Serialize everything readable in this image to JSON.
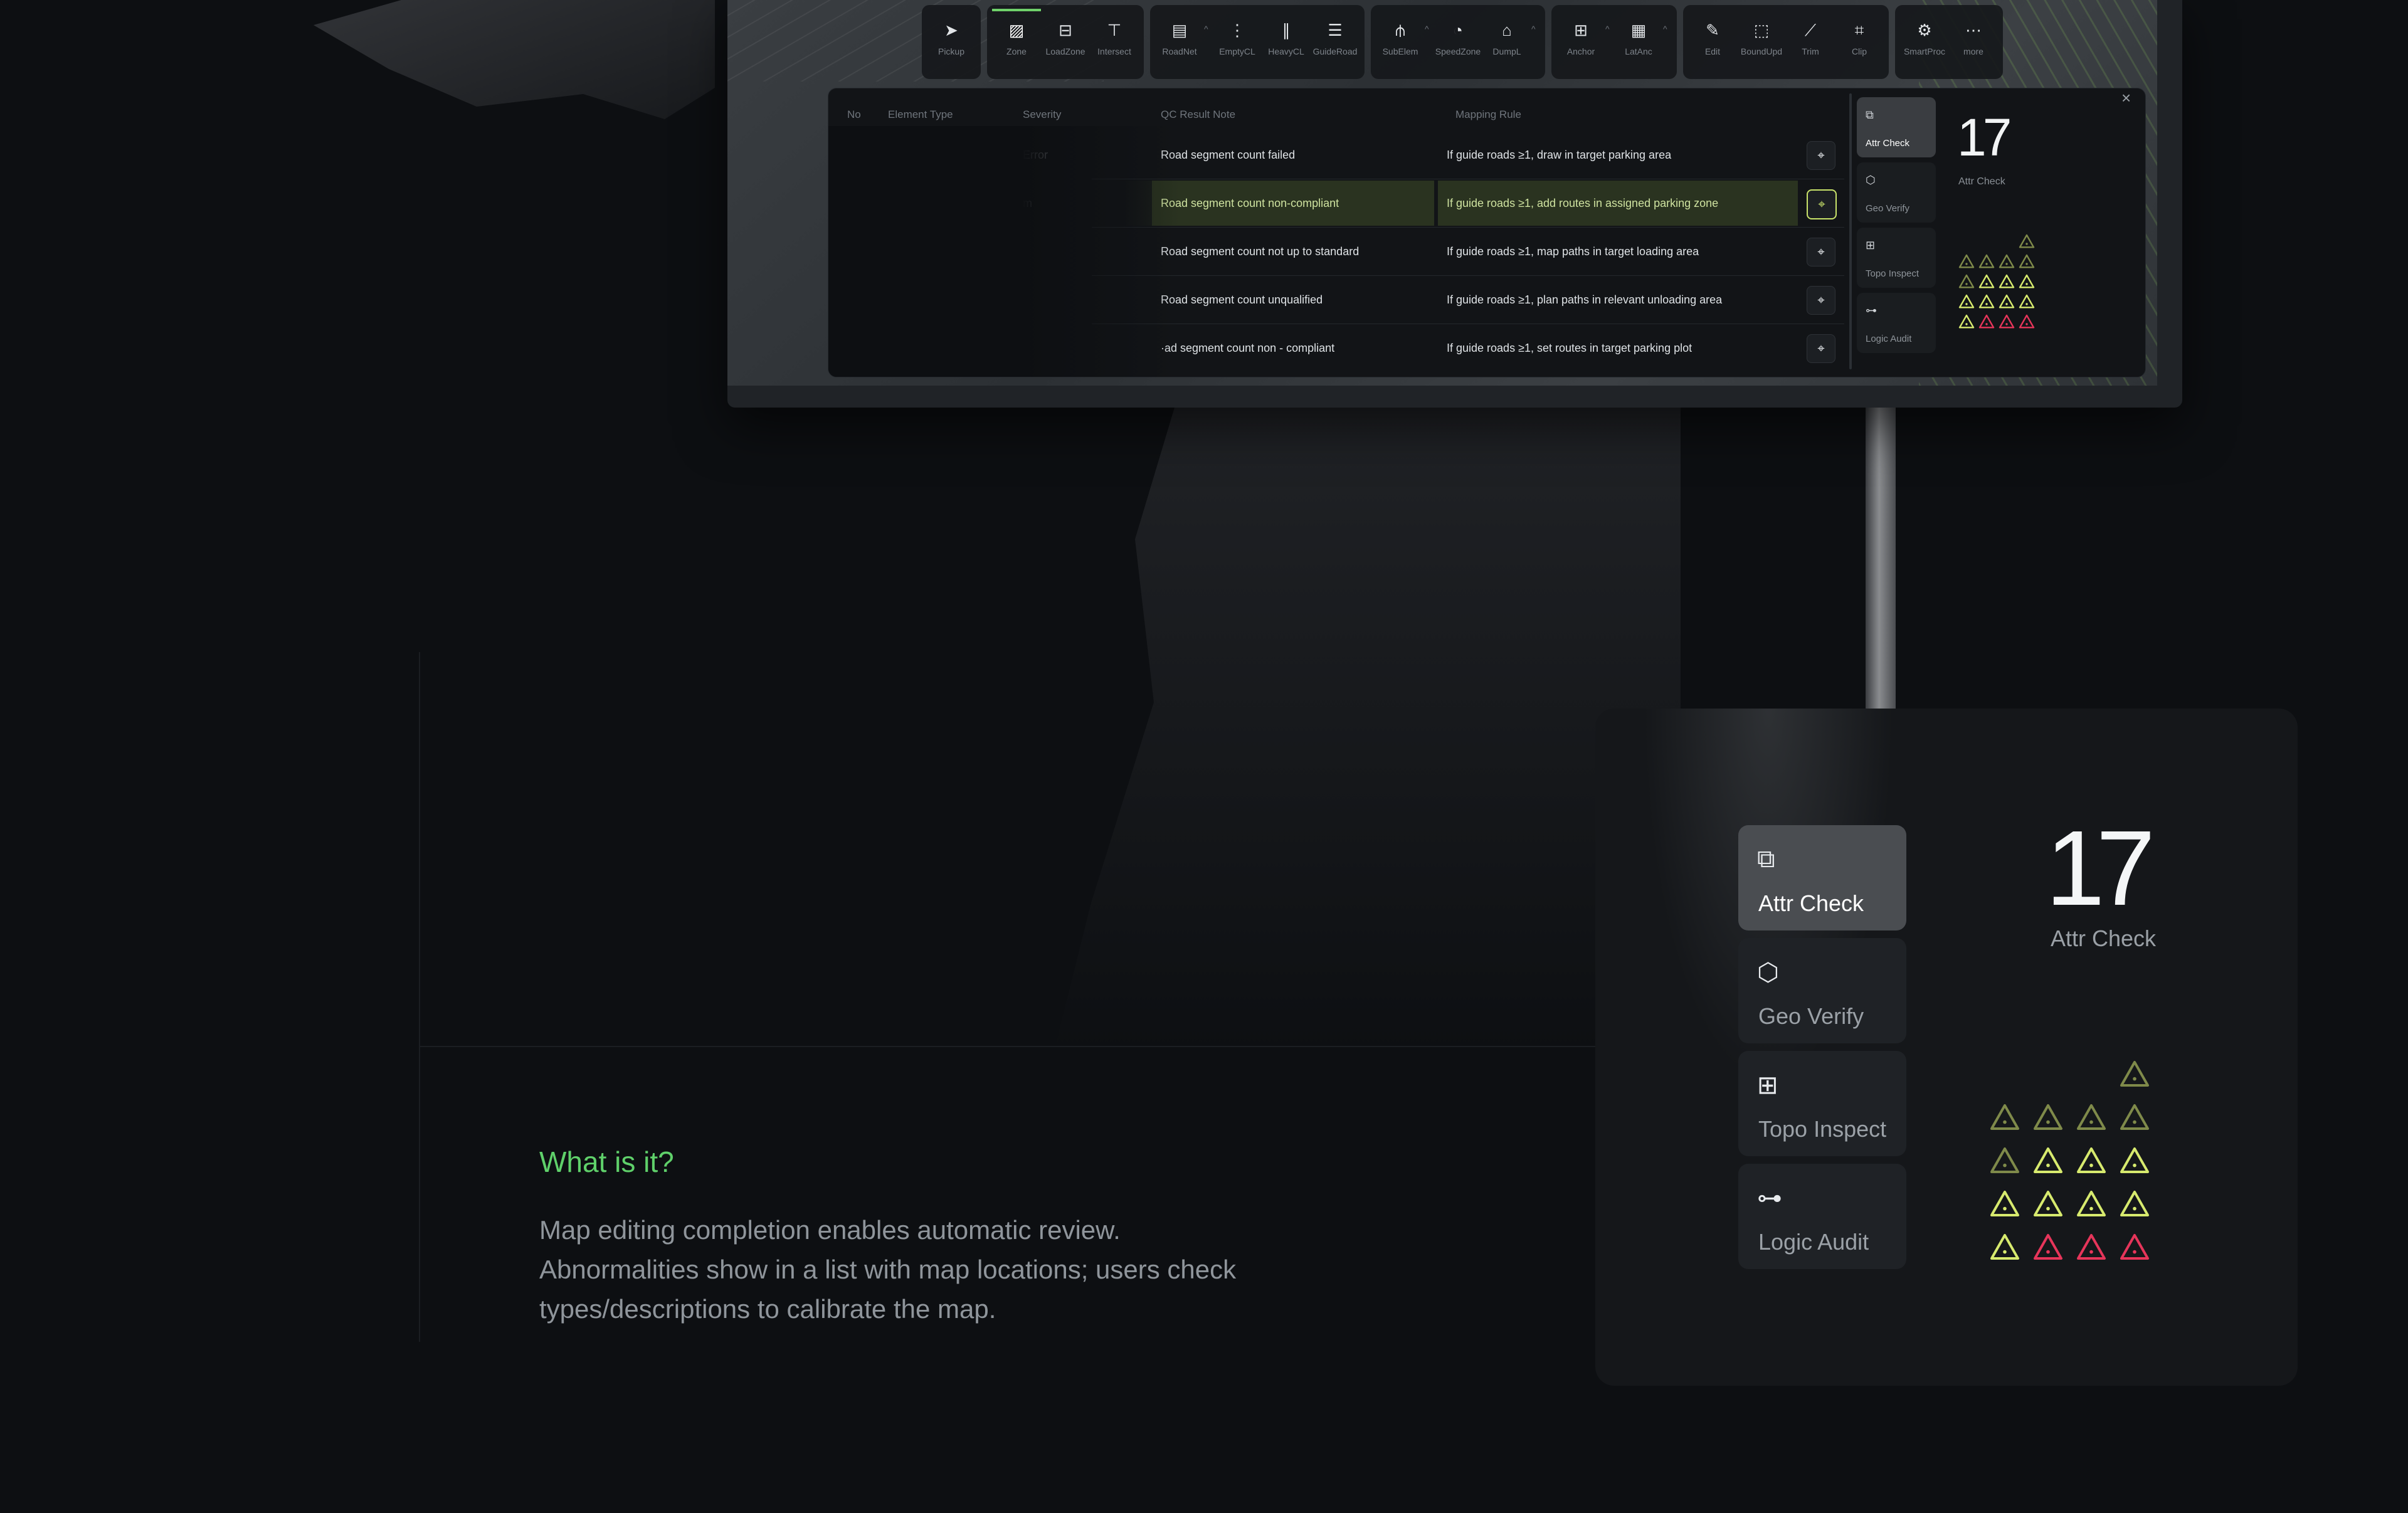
{
  "toolbar": {
    "groups": [
      [
        {
          "icon": "cursor-icon",
          "label": "Pickup"
        }
      ],
      [
        {
          "icon": "zone-icon",
          "label": "Zone",
          "active": true
        },
        {
          "icon": "loadzone-icon",
          "label": "LoadZone"
        },
        {
          "icon": "intersect-icon",
          "label": "Intersect"
        }
      ],
      [
        {
          "icon": "roadnet-icon",
          "label": "RoadNet",
          "caret": true
        },
        {
          "icon": "emptycl-icon",
          "label": "EmptyCL"
        },
        {
          "icon": "heavycl-icon",
          "label": "HeavyCL"
        },
        {
          "icon": "guideroad-icon",
          "label": "GuideRoad"
        }
      ],
      [
        {
          "icon": "subelem-icon",
          "label": "SubElem",
          "caret": true
        },
        {
          "icon": "speedzone-icon",
          "label": "SpeedZone"
        },
        {
          "icon": "dumpl-icon",
          "label": "DumpL",
          "caret": true
        }
      ],
      [
        {
          "icon": "anchor-icon",
          "label": "Anchor",
          "caret": true
        },
        {
          "icon": "latanc-icon",
          "label": "LatAnc",
          "caret": true
        }
      ],
      [
        {
          "icon": "edit-icon",
          "label": "Edit"
        },
        {
          "icon": "boundupd-icon",
          "label": "BoundUpd"
        },
        {
          "icon": "trim-icon",
          "label": "Trim"
        },
        {
          "icon": "clip-icon",
          "label": "Clip"
        }
      ],
      [
        {
          "icon": "smartproc-icon",
          "label": "SmartProc"
        },
        {
          "icon": "more-icon",
          "label": "more"
        }
      ]
    ]
  },
  "qc_table": {
    "columns": [
      "No",
      "Element Type",
      "Severity",
      "QC Result Note",
      "Mapping Rule"
    ],
    "rows": [
      {
        "severity": "Error",
        "note": "Road segment count failed",
        "rule": "If guide roads ≥1, draw in target parking area",
        "selected": false
      },
      {
        "severity": "m",
        "note": "Road segment count non-compliant",
        "rule": "If guide roads ≥1, add routes in assigned parking zone",
        "selected": true
      },
      {
        "severity": "",
        "note": "Road segment count not up to standard",
        "rule": "If guide roads ≥1, map paths in target loading area",
        "selected": false
      },
      {
        "severity": "",
        "note": "Road segment count unqualified",
        "rule": "If guide roads ≥1, plan paths in relevant unloading area",
        "selected": false
      },
      {
        "severity": "",
        "note": "·ad segment count non - compliant",
        "rule": "If guide roads ≥1, set routes in target parking plot",
        "selected": false
      }
    ],
    "close_label": "×"
  },
  "check_tabs": [
    {
      "icon": "attr-check-icon",
      "glyph": "⧉",
      "label": "Attr Check",
      "active": true
    },
    {
      "icon": "geo-verify-icon",
      "glyph": "⬡",
      "label": "Geo Verify",
      "active": false
    },
    {
      "icon": "topo-inspect-icon",
      "glyph": "⊞",
      "label": "Topo Inspect",
      "active": false
    },
    {
      "icon": "logic-audit-icon",
      "glyph": "⊶",
      "label": "Logic Audit",
      "active": false
    }
  ],
  "summary": {
    "count": "17",
    "label": "Attr Check"
  },
  "severity_grid": [
    [
      "",
      "",
      "",
      "olive"
    ],
    [
      "olive",
      "olive",
      "olive",
      "olive"
    ],
    [
      "olive",
      "lime",
      "lime",
      "lime"
    ],
    [
      "lime",
      "lime",
      "lime",
      "lime"
    ],
    [
      "lime",
      "red",
      "red",
      "red"
    ]
  ],
  "colors": {
    "olive": "#7f8a4a",
    "lime": "#d7ea6e",
    "red": "#e6355a",
    "accent": "#5fd06a"
  },
  "copy": {
    "headline": "What is it?",
    "body": "Map editing completion enables automatic review. Abnormalities show in a list with map locations; users check types/descriptions to calibrate the map."
  }
}
